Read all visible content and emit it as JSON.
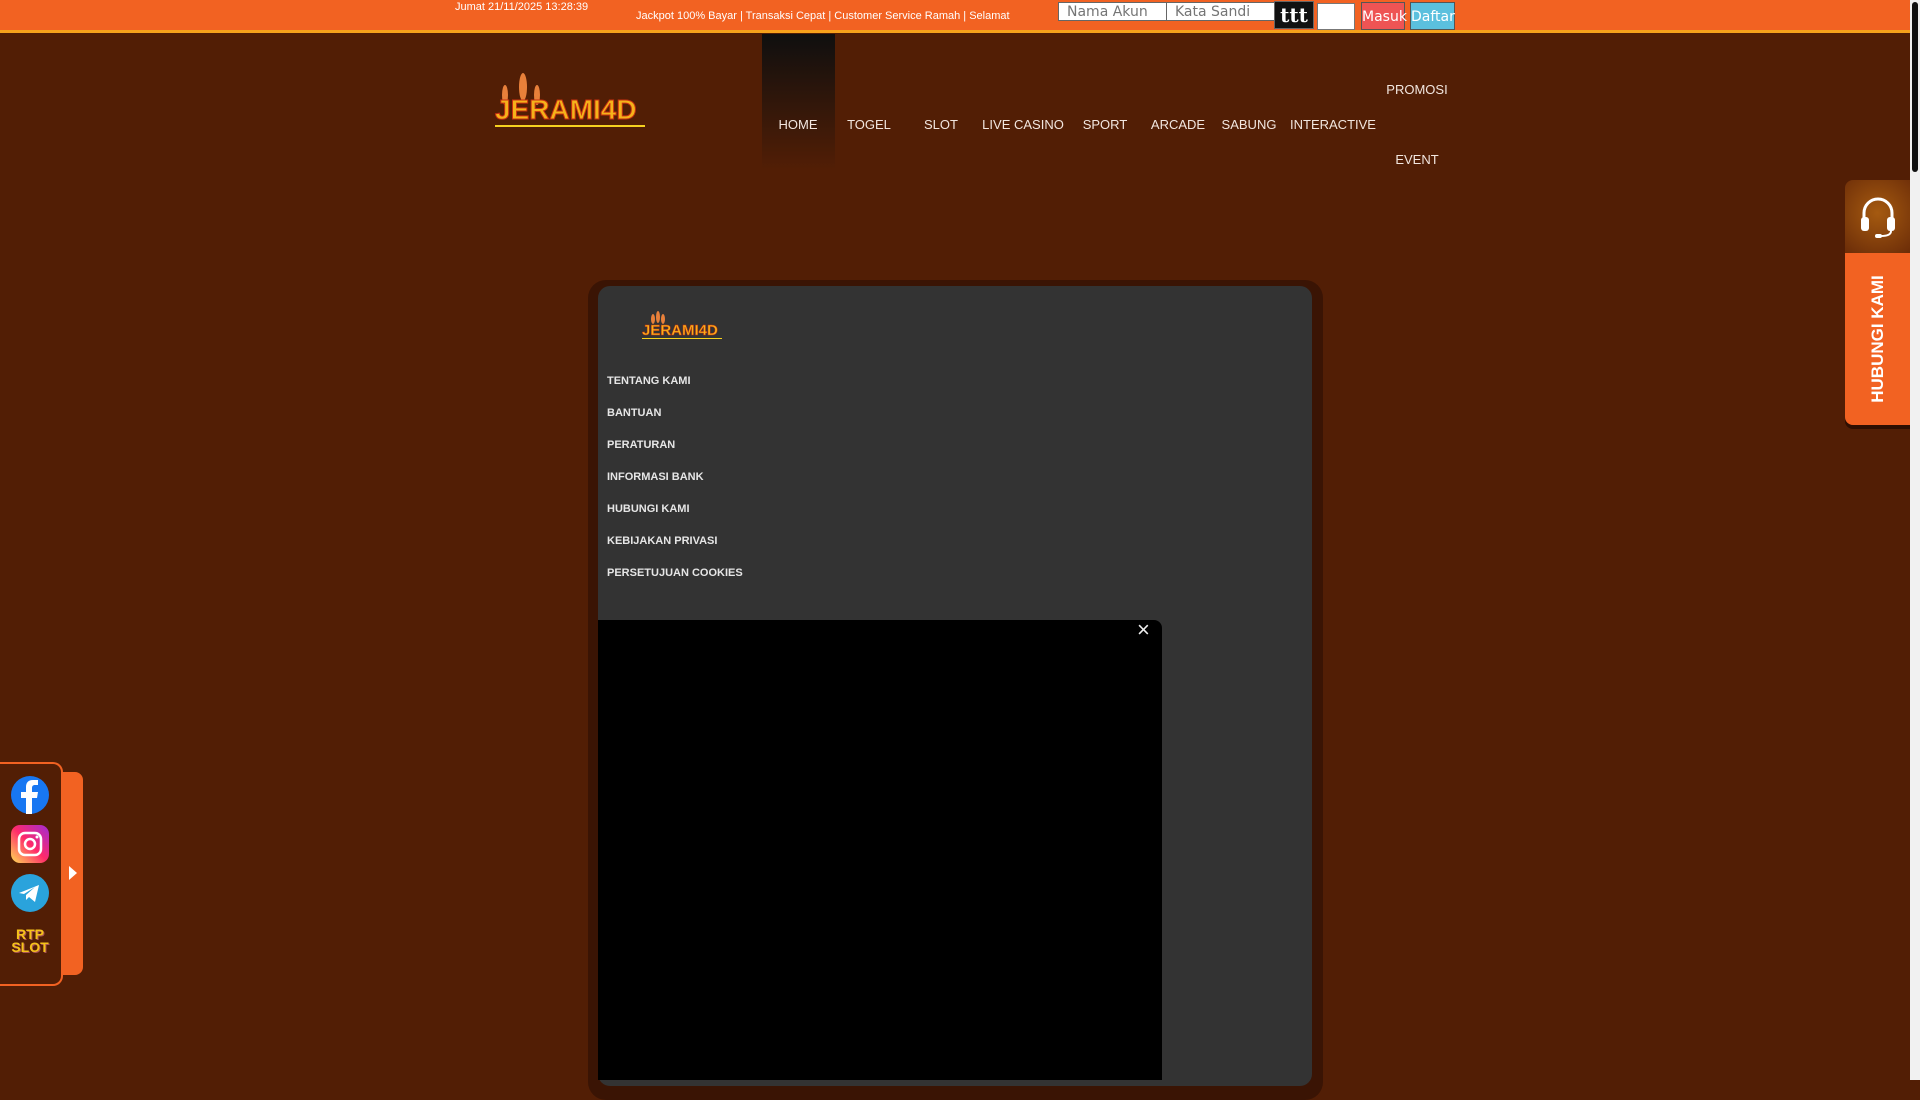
{
  "topbar": {
    "datetime": "Jumat 21/11/2025 13:28:39",
    "marquee": "Jackpot 100% Bayar | Transaksi Cepat | Customer Service Ramah | Selamat",
    "username_placeholder": "Nama Akun",
    "password_placeholder": "Kata Sandi",
    "captcha_text": "ttt",
    "login_label": "Masuk",
    "register_label": "Daftar"
  },
  "brand": {
    "logo_text": "JERAMI4D"
  },
  "nav": {
    "items": [
      "HOME",
      "TOGEL",
      "SLOT",
      "LIVE CASINO",
      "SPORT",
      "ARCADE",
      "SABUNG",
      "INTERACTIVE",
      "PROMOSI",
      "EVENT"
    ],
    "active": "HOME"
  },
  "footer": {
    "links": [
      "TENTANG KAMI",
      "BANTUAN",
      "PERATURAN",
      "INFORMASI BANK",
      "HUBUNGI KAMI",
      "KEBIJAKAN PRIVASI",
      "PERSETUJUAN COOKIES"
    ]
  },
  "video": {
    "close_label": "×"
  },
  "contact": {
    "label": "HUBUNGI KAMI"
  },
  "social": {
    "items": [
      "facebook",
      "instagram",
      "telegram",
      "rtp-slot"
    ],
    "rtp_text": "RTP SLOT"
  },
  "colors": {
    "accent": "#f26222",
    "background": "#521e05",
    "panel": "#333333",
    "login": "#ee5454",
    "register": "#5bc0de"
  }
}
